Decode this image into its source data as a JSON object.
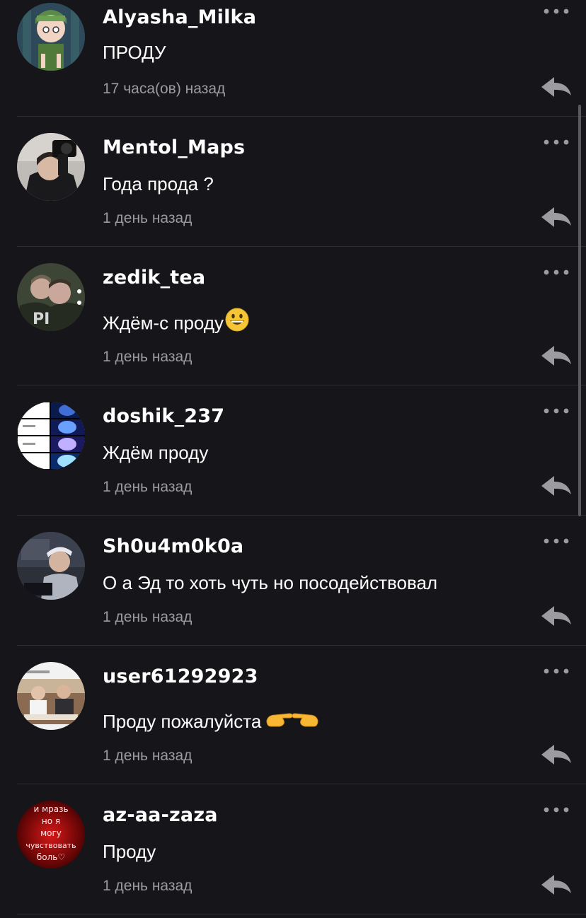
{
  "comments": [
    {
      "username": "Alyasha_Milka",
      "text": "ПРОДУ",
      "emoji": "",
      "time": "17 часа(ов) назад",
      "avatar": "anime-girl-avatar"
    },
    {
      "username": "Mentol_Maps",
      "text": "Года прода ?",
      "emoji": "",
      "time": "1 день назад",
      "avatar": "person-with-camera-avatar"
    },
    {
      "username": "zedik_tea",
      "text": "Ждём-с проду",
      "emoji": "grinning-face-emoji",
      "time": "1 день назад",
      "avatar": "two-people-avatar"
    },
    {
      "username": "doshik_237",
      "text": "Ждём проду",
      "emoji": "",
      "time": "1 день назад",
      "avatar": "brain-meme-avatar"
    },
    {
      "username": "Sh0u4m0k0a",
      "text": "О а Эд то хоть чуть но посодействовал",
      "emoji": "",
      "time": "1 день назад",
      "avatar": "person-at-computer-avatar"
    },
    {
      "username": "user61292923",
      "text": "Проду пожалуйста",
      "emoji": "pointing-hands-emoji",
      "time": "1 день назад",
      "avatar": "photo-post-avatar"
    },
    {
      "username": "az-aa-zaza",
      "text": "Проду",
      "emoji": "",
      "time": "1 день назад",
      "avatar": "neon-text-avatar",
      "avatar_text": [
        "и мразь",
        "но я",
        "могу",
        "чувствовать",
        "боль♡"
      ]
    }
  ],
  "icons": {
    "more": "more-options-icon",
    "reply": "reply-arrow-icon"
  },
  "colors": {
    "background": "#161519",
    "separator": "#2f2e33",
    "text": "#ffffff",
    "secondary_text": "#9c9ba0",
    "icon": "#9c9ba0"
  }
}
